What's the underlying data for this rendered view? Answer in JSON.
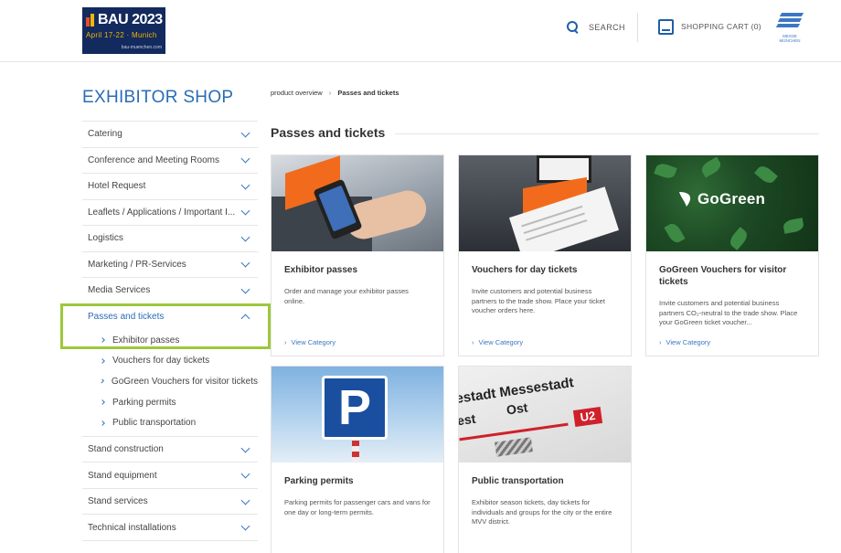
{
  "header": {
    "logo": {
      "title": "BAU 2023",
      "dates": "April 17-22 · Munich",
      "url": "bau-muenchen.com"
    },
    "search_label": "SEARCH",
    "cart_label": "SHOPPING CART (0)",
    "messe_label": "MESSE MÜNCHEN"
  },
  "sidebar": {
    "title": "EXHIBITOR SHOP",
    "items_before": [
      {
        "label": "Catering"
      },
      {
        "label": "Conference and Meeting Rooms"
      },
      {
        "label": "Hotel Request"
      },
      {
        "label": "Leaflets / Applications / Important I..."
      },
      {
        "label": "Logistics"
      },
      {
        "label": "Marketing / PR-Services"
      },
      {
        "label": "Media Services"
      }
    ],
    "open_item": {
      "label": "Passes and tickets",
      "children": [
        {
          "label": "Exhibitor passes"
        },
        {
          "label": "Vouchers for day tickets"
        },
        {
          "label": "GoGreen Vouchers for visitor tickets"
        },
        {
          "label": "Parking permits"
        },
        {
          "label": "Public transportation"
        }
      ]
    },
    "items_after": [
      {
        "label": "Stand construction"
      },
      {
        "label": "Stand equipment"
      },
      {
        "label": "Stand services"
      },
      {
        "label": "Technical installations"
      }
    ]
  },
  "breadcrumb": {
    "root": "product overview",
    "sep": "›",
    "current": "Passes and tickets"
  },
  "page_title": "Passes and tickets",
  "view_label": "View Category",
  "cards": [
    {
      "title": "Exhibitor passes",
      "desc": "Order and manage your exhibitor passes online."
    },
    {
      "title": "Vouchers for day tickets",
      "desc": "Invite customers and potential business partners to the trade show. Place your ticket voucher orders here."
    },
    {
      "title": "GoGreen Vouchers for visitor tickets",
      "desc": "Invite customers and potential business partners CO₂-neutral to the trade show. Place your GoGreen ticket voucher...",
      "img_text": "GoGreen"
    },
    {
      "title": "Parking permits",
      "desc": "Parking permits for passenger cars and vans for one day or long-term permits.",
      "img_text": "P"
    },
    {
      "title": "Public transportation",
      "desc": "Exhibitor season tickets, day tickets for individuals and groups for the city or the entire MVV district.",
      "img_text": [
        "estadt Messestadt",
        "Ost",
        "est",
        "U2"
      ]
    }
  ]
}
